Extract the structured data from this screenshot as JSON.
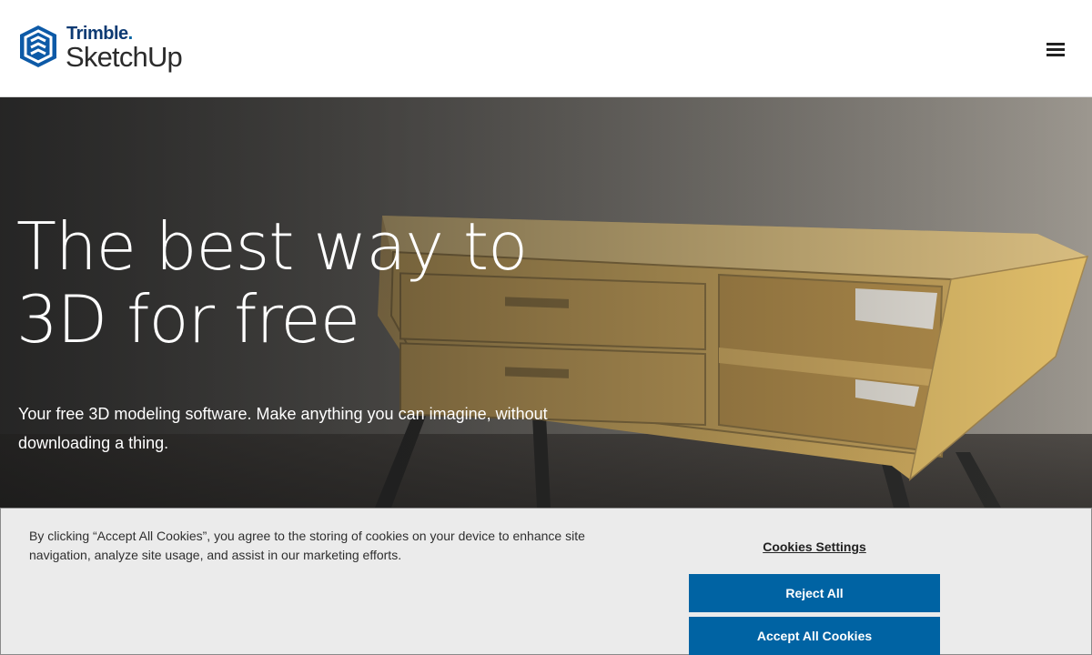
{
  "header": {
    "brand": "Trimble",
    "brand_dot": ".",
    "product": "SketchUp",
    "menu_icon": "hamburger-menu-icon"
  },
  "hero": {
    "title_line1": "The best way to",
    "title_line2": "3D for free",
    "subtitle": "Your free 3D modeling software. Make anything you can imagine, without downloading a thing."
  },
  "cookie_banner": {
    "message": "By clicking “Accept All Cookies”, you agree to the storing of cookies on your device to enhance site navigation, analyze site usage, and assist in our marketing efforts.",
    "settings_label": "Cookies Settings",
    "reject_label": "Reject All",
    "accept_label": "Accept All Cookies"
  },
  "colors": {
    "brand_blue": "#0063a3",
    "brand_dark_blue": "#0d3a73",
    "banner_bg": "#ebebeb"
  }
}
